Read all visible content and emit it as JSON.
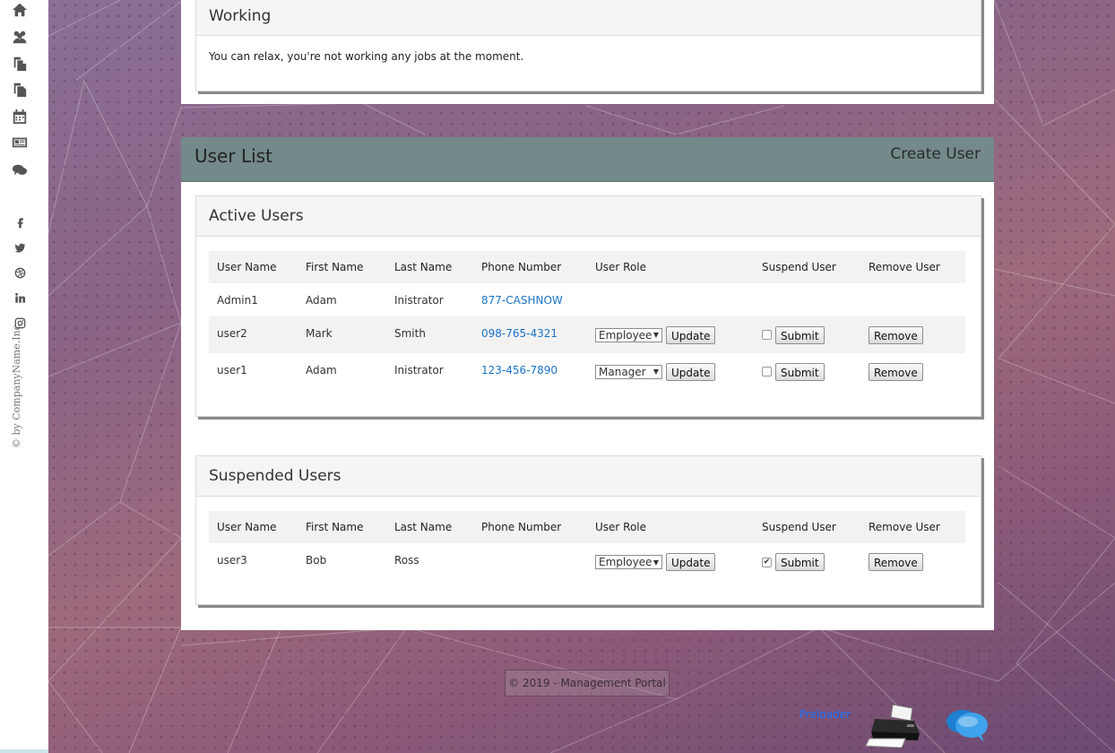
{
  "rail": {
    "icons": [
      "home-icon",
      "users-icon",
      "copy-icon",
      "files-icon",
      "calendar-icon",
      "newspaper-icon",
      "comments-icon"
    ],
    "social": [
      "facebook-icon",
      "twitter-icon",
      "dribbble-icon",
      "linkedin-icon",
      "instagram-icon"
    ],
    "copyright": "© by CompanyName.Inc"
  },
  "working": {
    "title": "Working",
    "message": "You can relax, you're not working any jobs at the moment."
  },
  "user_list": {
    "title": "User List",
    "create_label": "Create User"
  },
  "active": {
    "title": "Active Users",
    "headers": [
      "User Name",
      "First Name",
      "Last Name",
      "Phone Number",
      "User Role",
      "Suspend User",
      "Remove User"
    ],
    "rows": [
      {
        "username": "Admin1",
        "first": "Adam",
        "last": "Inistrator",
        "phone": "877-CASHNOW",
        "role": "",
        "suspended": false,
        "controls": false
      },
      {
        "username": "user2",
        "first": "Mark",
        "last": "Smith",
        "phone": "098-765-4321",
        "role": "Employee",
        "suspended": false,
        "controls": true
      },
      {
        "username": "user1",
        "first": "Adam",
        "last": "Inistrator",
        "phone": "123-456-7890",
        "role": "Manager",
        "suspended": false,
        "controls": true
      }
    ]
  },
  "suspended": {
    "title": "Suspended Users",
    "headers": [
      "User Name",
      "First Name",
      "Last Name",
      "Phone Number",
      "User Role",
      "Suspend User",
      "Remove User"
    ],
    "rows": [
      {
        "username": "user3",
        "first": "Bob",
        "last": "Ross",
        "phone": "",
        "role": "Employee",
        "suspended": true,
        "controls": true
      }
    ]
  },
  "buttons": {
    "update": "Update",
    "submit": "Submit",
    "remove": "Remove"
  },
  "footer": {
    "copyright": "© 2019 - Management Portal",
    "preloader": "Preloader"
  },
  "colors": {
    "header_bar": "#73898a",
    "phone_link": "#1a73c8",
    "preloader_link": "#1a73ff"
  }
}
